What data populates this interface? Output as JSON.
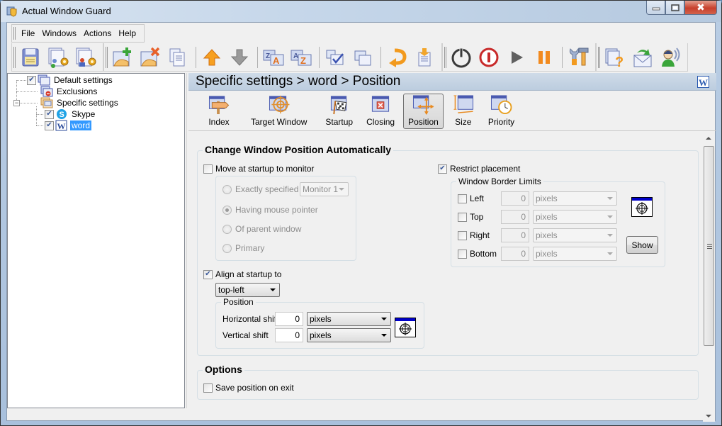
{
  "window": {
    "title": "Actual Window Guard",
    "controls": [
      "minimize",
      "maximize",
      "close"
    ]
  },
  "menu": {
    "items": [
      "File",
      "Windows",
      "Actions",
      "Help"
    ]
  },
  "toolbar": {
    "groups": [
      [
        "save-icon",
        "default-settings-icon",
        "specific-settings-icon"
      ],
      [
        "add-window-icon",
        "delete-window-icon",
        "copy-icon",
        "move-up-icon",
        "move-down-icon",
        "sort-za-icon",
        "sort-az-icon",
        "select-all-icon",
        "cascade-icon",
        "undo-icon",
        "import-icon"
      ],
      [
        "power-icon",
        "stop-icon",
        "play-icon",
        "pause-icon",
        "tools-icon"
      ],
      [
        "help-icon",
        "feedback-mail-icon",
        "support-icon"
      ]
    ]
  },
  "tree": {
    "items": [
      {
        "label": "Default settings",
        "checked": true,
        "icon": "window-icon",
        "level": 0
      },
      {
        "label": "Exclusions",
        "checked": null,
        "icon": "exclusion-icon",
        "level": 0
      },
      {
        "label": "Specific settings",
        "checked": null,
        "icon": "folder-windows-icon",
        "level": 0,
        "expanded": true
      },
      {
        "label": "Skype",
        "checked": true,
        "icon": "skype-icon",
        "level": 1
      },
      {
        "label": "word",
        "checked": true,
        "icon": "word-icon",
        "level": 1,
        "selected": true
      }
    ]
  },
  "breadcrumb": {
    "text": "Specific settings > word > Position",
    "app_badge": "W"
  },
  "tabs": [
    {
      "label": "Index",
      "icon": "signpost-icon",
      "active": false
    },
    {
      "label": "Target Window",
      "icon": "crosshair-target-icon",
      "active": false
    },
    {
      "label": "Startup",
      "icon": "checkered-flag-icon",
      "active": false
    },
    {
      "label": "Closing",
      "icon": "close-window-icon",
      "active": false
    },
    {
      "label": "Position",
      "icon": "move-arrows-icon",
      "active": true
    },
    {
      "label": "Size",
      "icon": "resize-icon",
      "active": false
    },
    {
      "label": "Priority",
      "icon": "clock-icon",
      "active": false
    }
  ],
  "position_group": {
    "title": "Change Window Position Automatically",
    "move_to_monitor": {
      "label": "Move at startup to monitor",
      "checked": false,
      "options": [
        {
          "label": "Exactly specified",
          "selected": false
        },
        {
          "label": "Having mouse pointer",
          "selected": true
        },
        {
          "label": "Of parent window",
          "selected": false
        },
        {
          "label": "Primary",
          "selected": false
        }
      ],
      "monitor_select": "Monitor 1"
    },
    "align_at_startup": {
      "label": "Align at startup to",
      "checked": true,
      "value": "top-left",
      "position_title": "Position",
      "horizontal_label": "Horizontal shift",
      "horizontal_value": "0",
      "horizontal_unit": "pixels",
      "vertical_label": "Vertical shift",
      "vertical_value": "0",
      "vertical_unit": "pixels"
    },
    "restrict_placement": {
      "label": "Restrict placement",
      "checked": true,
      "limits_title": "Window Border Limits",
      "limits": [
        {
          "label": "Left",
          "checked": false,
          "value": "0",
          "unit": "pixels"
        },
        {
          "label": "Top",
          "checked": false,
          "value": "0",
          "unit": "pixels"
        },
        {
          "label": "Right",
          "checked": false,
          "value": "0",
          "unit": "pixels"
        },
        {
          "label": "Bottom",
          "checked": false,
          "value": "0",
          "unit": "pixels"
        }
      ],
      "show_button": "Show"
    }
  },
  "options_group": {
    "title": "Options",
    "save_position_on_exit": {
      "label": "Save position on exit",
      "checked": false
    }
  }
}
